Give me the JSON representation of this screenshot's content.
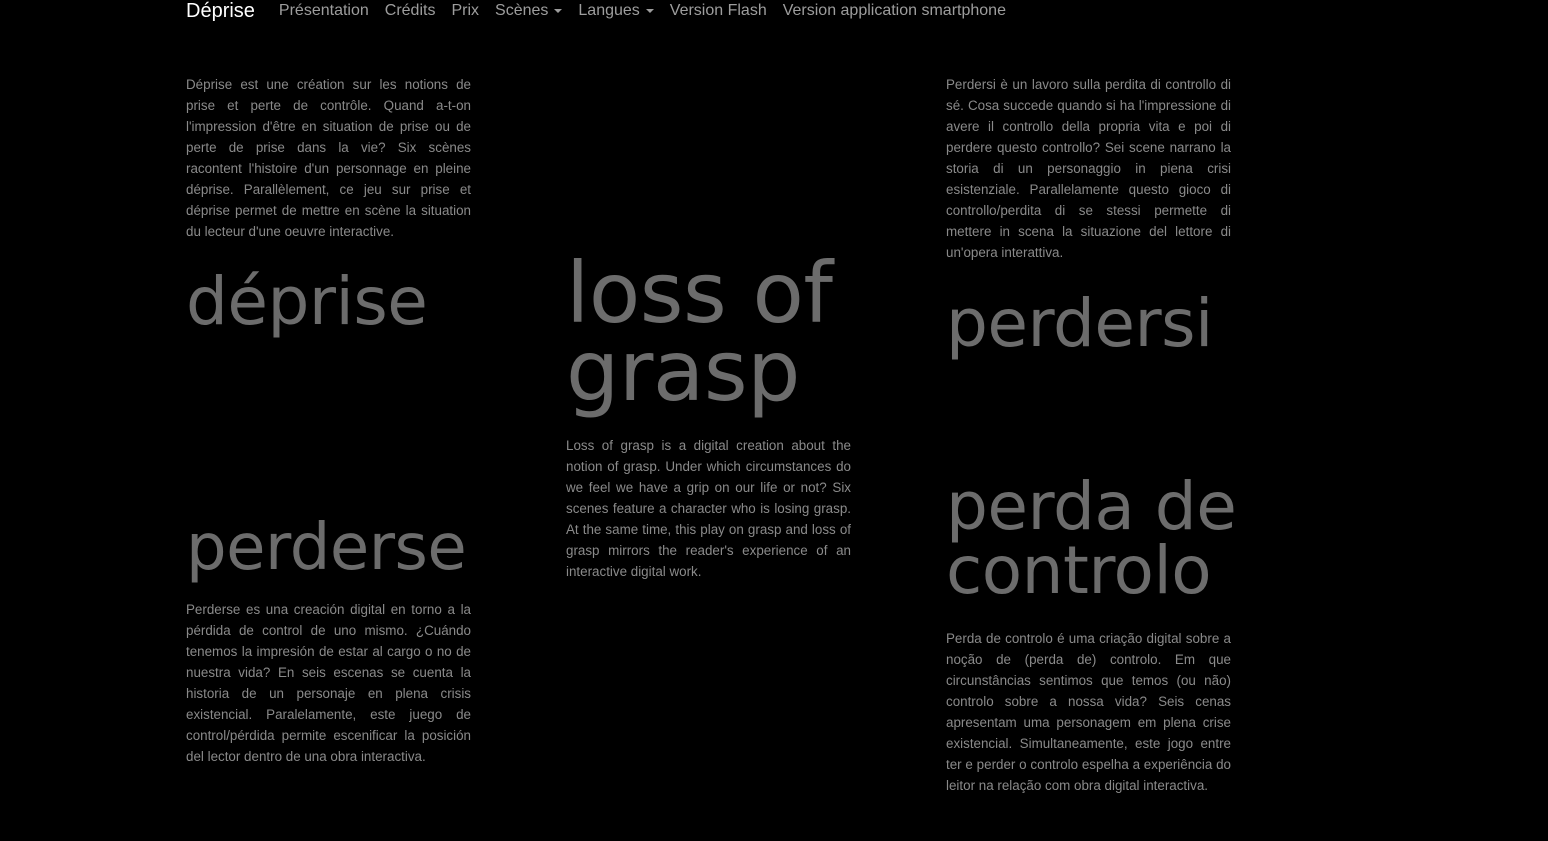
{
  "navbar": {
    "brand": "Déprise",
    "items": [
      {
        "label": "Présentation"
      },
      {
        "label": "Crédits"
      },
      {
        "label": "Prix"
      },
      {
        "label": "Scènes"
      },
      {
        "label": "Langues"
      },
      {
        "label": "Version Flash"
      },
      {
        "label": "Version application smartphone"
      }
    ]
  },
  "sections": {
    "fr": {
      "title": "déprise",
      "text": "Déprise est une création sur les notions de prise et perte de contrôle. Quand a-t-on l'impression d'être en situation de prise ou de perte de prise dans la vie? Six scènes racontent l'histoire d'un personnage en pleine déprise. Parallèlement, ce jeu sur prise et déprise permet de mettre en scène la situation du lecteur d'une oeuvre interactive."
    },
    "en": {
      "title_line1": "loss of",
      "title_line2": "grasp",
      "text": "Loss of grasp is a digital creation about the notion of grasp. Under which circumstances do we feel we have a grip on our life or not? Six scenes feature a character who is losing grasp. At the same time, this play on grasp and loss of grasp mirrors the reader's experience of an interactive digital work."
    },
    "it": {
      "title": "perdersi",
      "text": "Perdersi è un lavoro sulla perdita di controllo di sé. Cosa succede quando si ha l'impressione di avere il controllo della propria vita e poi di perdere questo controllo? Sei scene narrano la storia di un personaggio in piena crisi esistenziale. Parallelamente questo gioco di controllo/perdita di se stessi permette di mettere in scena la situazione del lettore di un'opera interattiva."
    },
    "es": {
      "title": "perderse",
      "text": "Perderse es una creación digital en torno a la pérdida de control de uno mismo. ¿Cuándo tenemos la impresión de estar al cargo o no de nuestra vida? En seis escenas se cuenta la historia de un personaje en plena crisis existencial. Paralelamente, este juego de control/pérdida permite escenificar la posición del lector dentro de una obra interactiva."
    },
    "pt": {
      "title_line1": "perda de",
      "title_line2": "controlo",
      "text": "Perda de controlo é uma criação digital sobre a noção de (perda de) controlo. Em que circunstâncias sentimos que temos (ou não) controlo sobre a nossa vida? Seis cenas apresentam uma personagem em plena crise existencial. Simultaneamente, este jogo entre ter e perder o controlo espelha a experiência do leitor na relação com obra digital interactiva."
    }
  },
  "colors": {
    "background": "#000000",
    "brand_text": "#ffffff",
    "nav_text": "#9d9d9d",
    "body_text": "#8a8a8a",
    "title_text": "#6c6c6c"
  },
  "icons": [
    "caret-down-icon"
  ]
}
